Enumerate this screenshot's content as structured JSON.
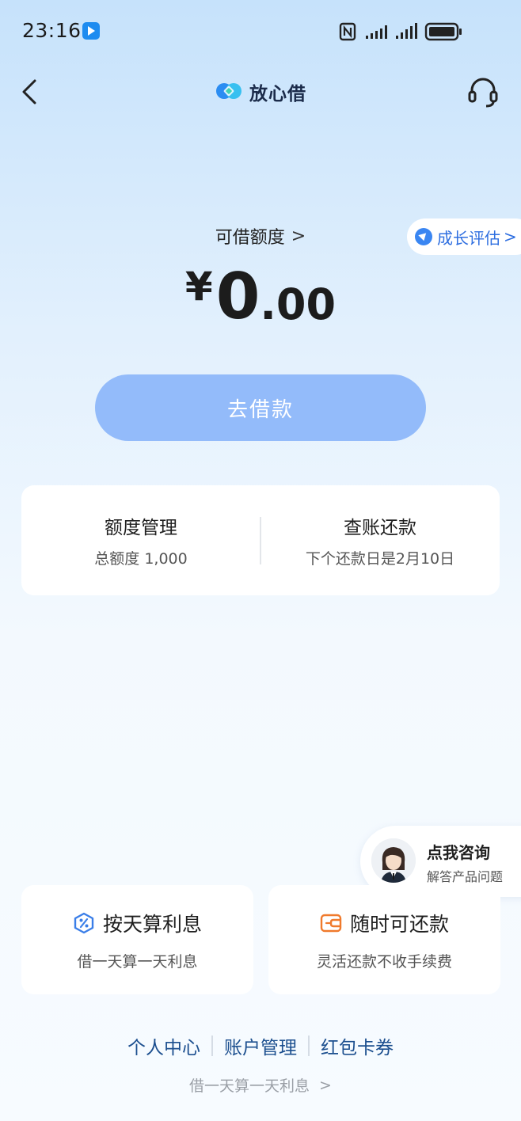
{
  "status_bar": {
    "time": "23:16",
    "app_icon": "play-badge-icon",
    "nfc_icon": "nfc-icon",
    "signal_icon": "cell-signal-icon",
    "battery_icon": "battery-icon"
  },
  "nav": {
    "back_icon": "chevron-left-icon",
    "logo_icon": "heart-logo-icon",
    "title": "放心借",
    "service_icon": "headset-icon"
  },
  "quota": {
    "label": "可借额度",
    "chevron": ">",
    "currency": "¥",
    "amount_int": "0",
    "amount_dec": ".00"
  },
  "growth_badge": {
    "label": "成长评估",
    "chevron": ">"
  },
  "borrow_button": {
    "label": "去借款"
  },
  "management": {
    "left": {
      "title": "额度管理",
      "subtitle": "总额度 1,000"
    },
    "right": {
      "title": "查账还款",
      "subtitle": "下个还款日是2月10日"
    }
  },
  "consult": {
    "title": "点我咨询",
    "subtitle": "解答产品问题"
  },
  "features": [
    {
      "icon": "percent-shield-icon",
      "title": "按天算利息",
      "subtitle": "借一天算一天利息"
    },
    {
      "icon": "wallet-icon",
      "title": "随时可还款",
      "subtitle": "灵活还款不收手续费"
    }
  ],
  "bottom": {
    "links": [
      "个人中心",
      "账户管理",
      "红包卡券"
    ],
    "slogan": "借一天算一天利息",
    "chevron": ">"
  },
  "colors": {
    "accent": "#3a86f2",
    "button": "#93bbfa",
    "link": "#1c4f8f",
    "wallet_icon": "#f07a2c"
  }
}
